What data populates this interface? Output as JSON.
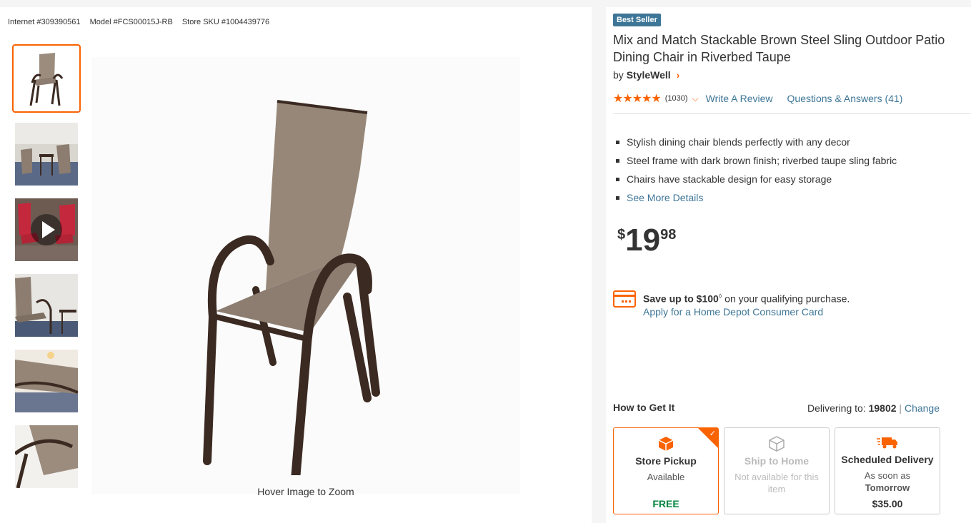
{
  "ids": {
    "internet": "Internet #309390561",
    "model": "Model #FCS00015J-RB",
    "sku": "Store SKU #1004439776"
  },
  "gallery": {
    "thumbnails": [
      "chair-front",
      "patio-scene",
      "video-red-chairs",
      "chair-porch",
      "chair-closeup",
      "chair-arm-detail"
    ],
    "hover_text": "Hover Image to Zoom"
  },
  "product": {
    "badge": "Best Seller",
    "title": "Mix and Match Stackable Brown Steel Sling Outdoor Patio Dining Chair in Riverbed Taupe",
    "by": "by",
    "brand": "StyleWell",
    "rating_count": "(1030)",
    "write_review": "Write A Review",
    "qa": "Questions & Answers (41)",
    "bullets": [
      "Stylish dining chair blends perfectly with any decor",
      "Steel frame with dark brown finish; riverbed taupe sling fabric",
      "Chairs have stackable design for easy storage"
    ],
    "see_more": "See More Details",
    "price": {
      "currency": "$",
      "dollars": "19",
      "cents": "98"
    }
  },
  "promo": {
    "save_bold": "Save up to $100",
    "save_sup": "◊",
    "save_rest": " on your qualifying purchase.",
    "apply_link": "Apply for a Home Depot Consumer Card"
  },
  "fulfillment": {
    "heading": "How to Get It",
    "delivering_label": "Delivering to: ",
    "zip": "19802",
    "sep": " | ",
    "change": "Change",
    "options": [
      {
        "name": "Store Pickup",
        "sub": "Available",
        "foot": "FREE"
      },
      {
        "name": "Ship to Home",
        "sub": "Not available for this item",
        "foot": ""
      },
      {
        "name": "Scheduled Delivery",
        "sub": "As soon as",
        "sub_bold": "Tomorrow",
        "foot": "$35.00"
      }
    ]
  },
  "colors": {
    "accent": "#f96302",
    "link": "#3e7697",
    "badge": "#3e7697",
    "free": "#00843d"
  }
}
